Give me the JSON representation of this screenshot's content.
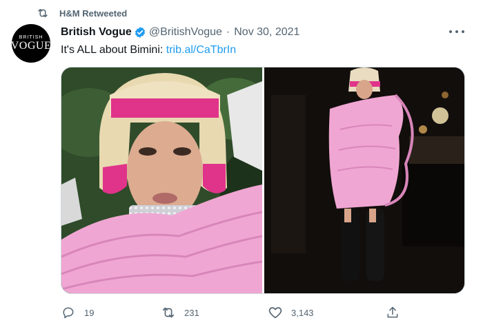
{
  "retweet": {
    "label": "H&M Retweeted",
    "icon": "retweet-icon"
  },
  "account": {
    "avatar_line1": "BRITISH",
    "avatar_line2": "VOGUE",
    "display_name": "British Vogue",
    "verified": true,
    "handle": "@BritishVogue",
    "separator": "·",
    "date": "Nov 30, 2021"
  },
  "tweet": {
    "text": "It's ALL about Bimini: ",
    "link": "trib.al/CaTbrIn"
  },
  "media": [
    {
      "description": "close-up portrait photo"
    },
    {
      "description": "full-length photo"
    }
  ],
  "actions": {
    "reply": {
      "icon": "reply-icon",
      "count": "19"
    },
    "retweet": {
      "icon": "retweet-icon",
      "count": "231"
    },
    "like": {
      "icon": "heart-icon",
      "count": "3,143"
    },
    "share": {
      "icon": "share-icon"
    }
  },
  "colors": {
    "link": "#1d9bf0",
    "secondary_text": "#536471",
    "verified": "#1d9bf0"
  }
}
